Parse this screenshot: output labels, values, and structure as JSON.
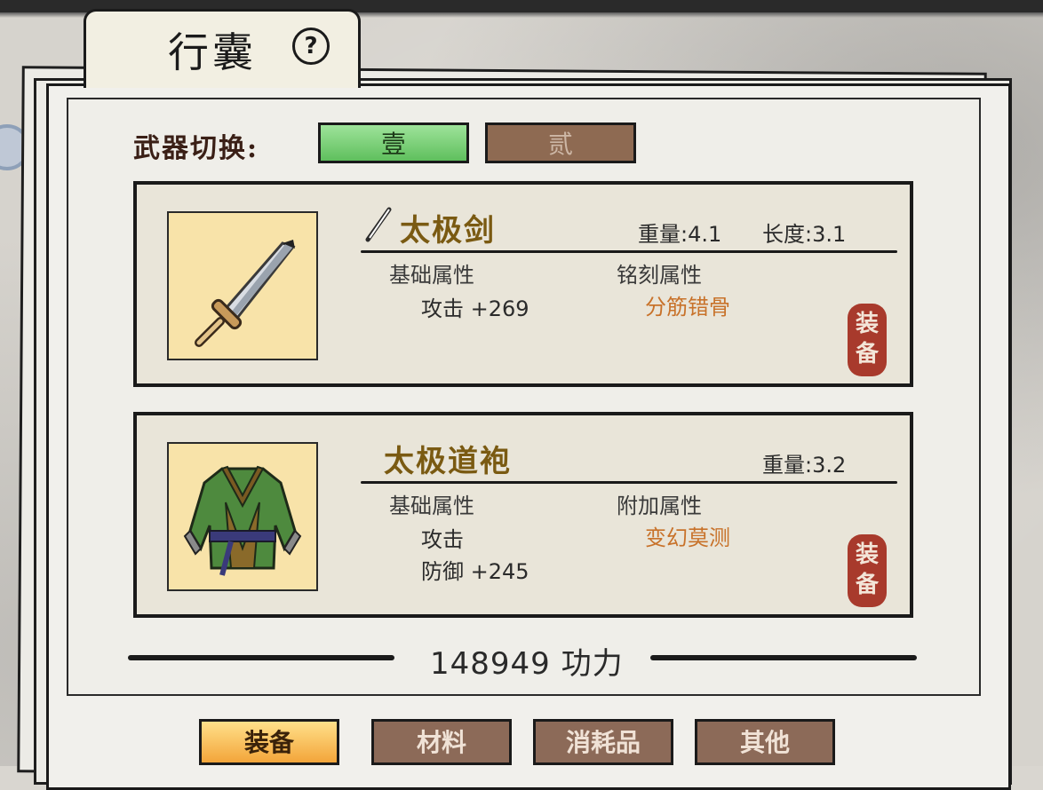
{
  "header": {
    "title": "行囊",
    "help_icon": "question-circle-icon"
  },
  "weapon_switch": {
    "label": "武器切换:",
    "options": [
      "壹",
      "贰"
    ],
    "selected": "壹"
  },
  "items": [
    {
      "name": "太极剑",
      "icon": "sword-icon",
      "weight_label": "重量:4.1",
      "length_label": "长度:3.1",
      "base_header": "基础属性",
      "extra_header": "铭刻属性",
      "base_lines": [
        "攻击 +269"
      ],
      "extra_lines": [
        "分筋错骨"
      ],
      "equip_label": [
        "装",
        "备"
      ]
    },
    {
      "name": "太极道袍",
      "icon": "robe-icon",
      "weight_label": "重量:3.2",
      "base_header": "基础属性",
      "extra_header": "附加属性",
      "base_lines": [
        "攻击",
        "防御 +245"
      ],
      "extra_lines": [
        "变幻莫测"
      ],
      "equip_label": [
        "装",
        "备"
      ]
    }
  ],
  "power": {
    "text": "148949 功力"
  },
  "tabs": [
    {
      "label": "装备",
      "active": true
    },
    {
      "label": "材料",
      "active": false
    },
    {
      "label": "消耗品",
      "active": false
    },
    {
      "label": "其他",
      "active": false
    }
  ],
  "colors": {
    "active_tab": "#f3a53a",
    "selected_switch": "#5fbf5d",
    "equip": "#a83a2c",
    "item_name": "#7a5a12",
    "extra_attr": "#c8722a"
  }
}
